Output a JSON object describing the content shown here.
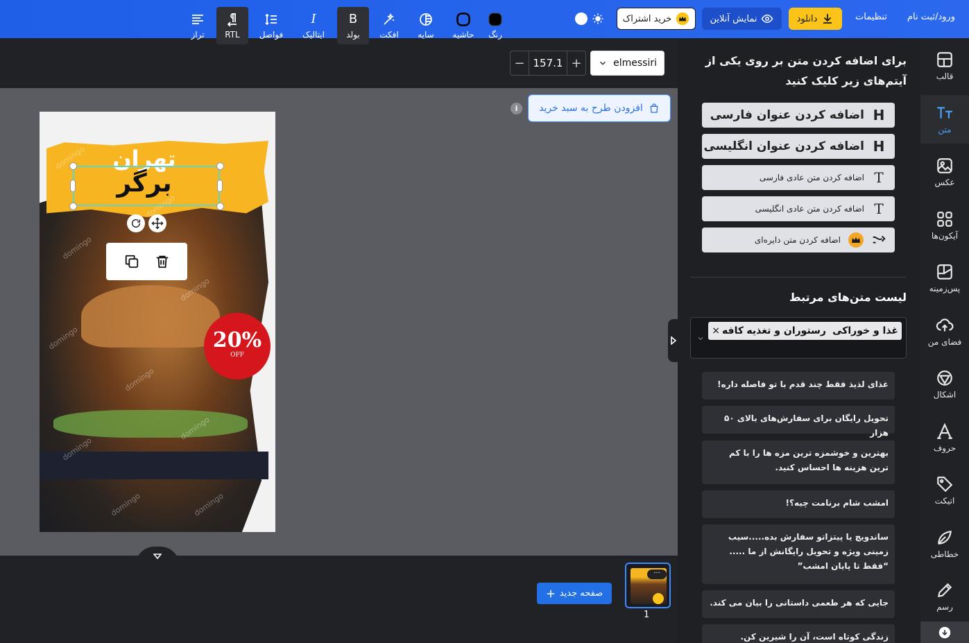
{
  "header": {
    "login_label": "ورود/ثبت نام",
    "settings_label": "تنظیمات",
    "download_label": "دانلود",
    "preview_label": "نمایش آنلاین",
    "subscribe_label": "خرید اشتراک"
  },
  "sidebar": {
    "items": [
      {
        "label": "قالب",
        "icon": "template-icon"
      },
      {
        "label": "متن",
        "icon": "text-icon",
        "active": true
      },
      {
        "label": "عکس",
        "icon": "image-icon"
      },
      {
        "label": "آیکون‌ها",
        "icon": "icons-grid-icon"
      },
      {
        "label": "پس‌زمینه",
        "icon": "background-icon"
      },
      {
        "label": "فضای من",
        "icon": "cloud-upload-icon"
      },
      {
        "label": "اشکال",
        "icon": "shapes-icon"
      },
      {
        "label": "حروف",
        "icon": "letters-icon"
      },
      {
        "label": "اتیکت",
        "icon": "sticker-icon"
      },
      {
        "label": "خطاطی",
        "icon": "calligraphy-icon"
      },
      {
        "label": "رسم",
        "icon": "pencil-icon"
      }
    ]
  },
  "panel": {
    "title": "برای اضافه کردن متن بر روی یکی از آیتم‌های زیر کلیک کنید",
    "add_buttons": [
      {
        "label": "اضافه کردن عنوان فارسی",
        "icon": "H"
      },
      {
        "label": "اضافه کردن عنوان انگلیسی",
        "icon": "H"
      },
      {
        "label": "اضافه کردن متن عادی فارسی",
        "icon": "T"
      },
      {
        "label": "اضافه کردن متن عادی انگلیسی",
        "icon": "T"
      },
      {
        "label": "اضافه کردن متن دایره‌ای",
        "icon": "curve-text-icon"
      }
    ],
    "related_title": "لیست متن‌های مرتبط",
    "tags": [
      "غذا و خوراکی",
      "رستوران و تغذیه",
      "کافه"
    ],
    "texts": [
      "غذای لذیذ فقط چند قدم با تو فاصله داره!",
      "تحویل رایگان برای سفارش‌های بالای ۵۰ هزار",
      "بهترین و خوشمزه ترین مزه ها را با کم ترین هزینه ها احساس کنید.",
      "امشب شام برنامت چیه؟!",
      "ساندویچ یا پیتزاتو سفارش بده.....سیب زمینی ویژه و تحویل رایگانش از ما ..... “فقط تا پایان امشب”",
      "جایی که هر طعمی داستانی را بیان می کند.",
      "زندگی کوتاه است، آن را شیرین کن."
    ]
  },
  "toolbar": {
    "font_name": "elmessiri",
    "font_size": "157.1",
    "tools": [
      {
        "label": "رنگ",
        "icon": "color-swatch-icon"
      },
      {
        "label": "حاشیه",
        "icon": "border-icon"
      },
      {
        "label": "سایه",
        "icon": "shadow-icon"
      },
      {
        "label": "افکت",
        "icon": "effect-wand-icon"
      },
      {
        "label": "بولد",
        "icon": "bold-icon"
      },
      {
        "label": "ایتالیک",
        "icon": "italic-icon"
      },
      {
        "label": "فواصل",
        "icon": "spacing-icon"
      },
      {
        "label": "RTL",
        "icon": "rtl-icon"
      },
      {
        "label": "تراز",
        "icon": "align-icon"
      }
    ]
  },
  "canvas": {
    "cart_label": "افزودن طرح به سبد خرید",
    "info_glyph": "i",
    "poster": {
      "title_line1": "تهران",
      "title_line2": "برگر",
      "sale_percent": "20%",
      "sale_off": "OFF",
      "watermark": "domingo"
    }
  },
  "pages": {
    "new_page_label": "صفحه جدید",
    "page_number": "1"
  },
  "colors": {
    "topbar": "#2467ec",
    "download": "#fcc419",
    "accent": "#3c8cff",
    "sale": "#d6161d"
  }
}
